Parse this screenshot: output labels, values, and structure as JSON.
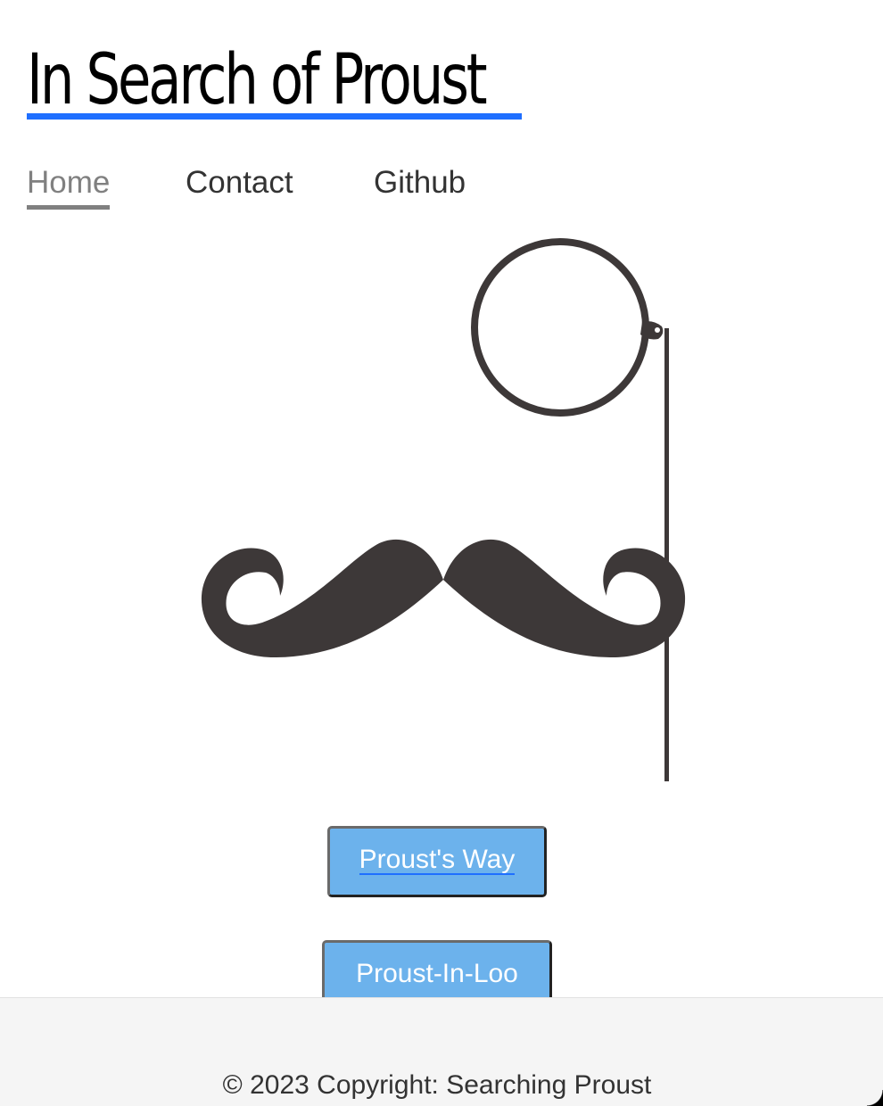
{
  "header": {
    "title": "In Search of Proust"
  },
  "nav": {
    "items": [
      {
        "label": "Home",
        "active": true
      },
      {
        "label": "Contact",
        "active": false
      },
      {
        "label": "Github",
        "active": false
      }
    ]
  },
  "illustration": {
    "icon": "monocle-mustache-icon",
    "color": "#3d3838"
  },
  "buttons": {
    "proust_way": "Proust's Way",
    "proust_in_loo": "Proust-In-Loo"
  },
  "footer": {
    "copyright": "© 2023 Copyright: Searching Proust"
  },
  "colors": {
    "link_accent": "#1f6fff",
    "button_bg": "#6cb2ec",
    "footer_bg": "#f5f5f5"
  }
}
